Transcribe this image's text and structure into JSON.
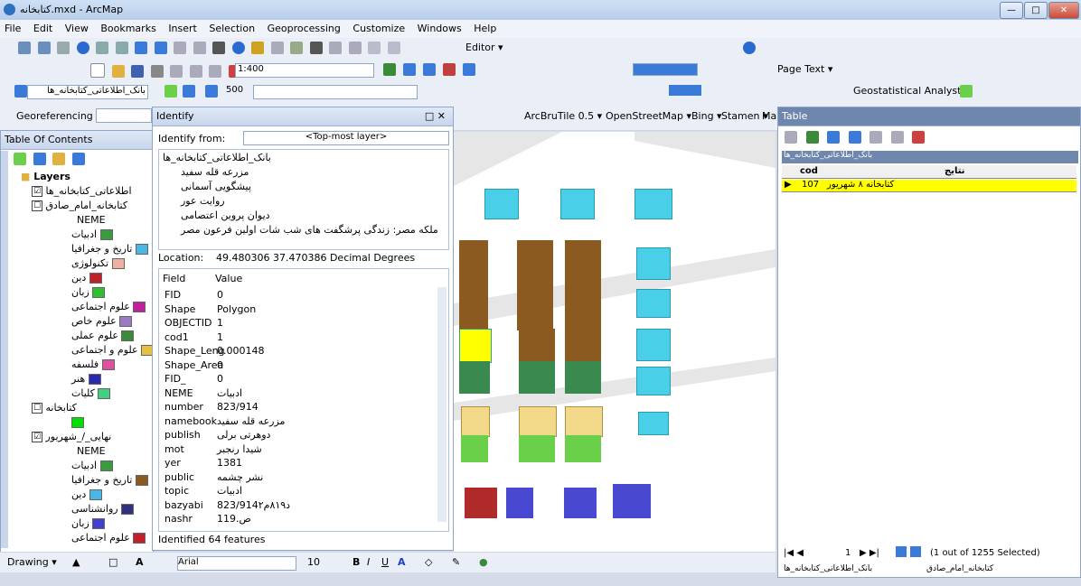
{
  "window": {
    "title": "کتابخانه.mxd - ArcMap",
    "min": "—",
    "max": "□",
    "close": "✕"
  },
  "menu": [
    "File",
    "Edit",
    "View",
    "Bookmarks",
    "Insert",
    "Selection",
    "Geoprocessing",
    "Customize",
    "Windows",
    "Help"
  ],
  "toolbar": {
    "editor": "Editor ▾",
    "scale": "1:400",
    "page_text": "Page Text ▾",
    "layer_select": "بانک_اطلاعاتی_کتابخانه_ها",
    "zoom_val": "500",
    "geostat": "Geostatistical Analyst ▾",
    "georef": "Georeferencing ▾",
    "basemap": "ArcBruTile 0.5 ▾",
    "osm": "OpenStreetMap ▾",
    "bing": "Bing ▾",
    "stamen": "Stamen ▾",
    "ma": "Ma",
    "drawing": "Drawing ▾",
    "font": "Arial",
    "font_size": "10",
    "bold": "B",
    "italic": "I",
    "underline": "U"
  },
  "toc": {
    "title": "Table Of Contents",
    "side_tab": "ArcToolbox",
    "layers_root": "Layers",
    "items": [
      {
        "label": "اطلاعاتی_کتابخانه_ها",
        "type": "layer",
        "checked": "☑"
      },
      {
        "label": "کتابخانه_امام_صادق",
        "type": "layer",
        "checked": "☐"
      },
      {
        "label": "NEME",
        "type": "field"
      },
      {
        "label": "ادبیات",
        "type": "cat",
        "color": "#3b9a3b"
      },
      {
        "label": "تاریخ و جغرافیا",
        "type": "cat",
        "color": "#49b6e6"
      },
      {
        "label": "تکنولوژی",
        "type": "cat",
        "color": "#f0b0a0"
      },
      {
        "label": "دین",
        "type": "cat",
        "color": "#c0202a"
      },
      {
        "label": "زبان",
        "type": "cat",
        "color": "#2fbf2f"
      },
      {
        "label": "علوم اجتماعی",
        "type": "cat",
        "color": "#c0209a"
      },
      {
        "label": "علوم خاص",
        "type": "cat",
        "color": "#9a7ac0"
      },
      {
        "label": "علوم عملی",
        "type": "cat",
        "color": "#3a8a3a"
      },
      {
        "label": "علوم و اجتماعی",
        "type": "cat",
        "color": "#e6c040"
      },
      {
        "label": "فلسفه",
        "type": "cat",
        "color": "#e050a0"
      },
      {
        "label": "هنر",
        "type": "cat",
        "color": "#2a2ab0"
      },
      {
        "label": "کلیات",
        "type": "cat",
        "color": "#40d080"
      },
      {
        "label": "کتابخانه",
        "type": "layer",
        "checked": "☐"
      },
      {
        "label": "",
        "type": "cat",
        "color": "#00e000"
      },
      {
        "label": "نهایی_/_شهریور",
        "type": "layer",
        "checked": "☑"
      },
      {
        "label": "NEME",
        "type": "field"
      },
      {
        "label": "ادبیات",
        "type": "cat",
        "color": "#3b9a3b"
      },
      {
        "label": "تاریخ و جغرافیا",
        "type": "cat",
        "color": "#8a5a20"
      },
      {
        "label": "دین",
        "type": "cat",
        "color": "#49b6e6"
      },
      {
        "label": "روانشناسی",
        "type": "cat",
        "color": "#303080"
      },
      {
        "label": "زبان",
        "type": "cat",
        "color": "#4040d0"
      },
      {
        "label": "علوم اجتماعی",
        "type": "cat",
        "color": "#c0202a"
      }
    ]
  },
  "identify": {
    "title": "Identify",
    "from_label": "Identify from:",
    "from_value": "<Top-most layer>",
    "tree_root": "بانک_اطلاعاتی_کتابخانه_ها",
    "tree_items": [
      "مزرعه قله سفید",
      "پیشگویی آسمانی",
      "روایت عور",
      "دیوان پروین اعتصامی",
      "ملکه مصر: زندگی پرشگفت های شب شات اولین فرعون مصر"
    ],
    "location_label": "Location:",
    "location_value": "49.480306 37.470386 Decimal Degrees",
    "col_field": "Field",
    "col_value": "Value",
    "rows": [
      {
        "f": "FID",
        "v": "0"
      },
      {
        "f": "Shape",
        "v": "Polygon"
      },
      {
        "f": "OBJECTID",
        "v": "1"
      },
      {
        "f": "cod1",
        "v": "1"
      },
      {
        "f": "Shape_Leng",
        "v": "0.000148"
      },
      {
        "f": "Shape_Area",
        "v": "0"
      },
      {
        "f": "FID_",
        "v": "0"
      },
      {
        "f": "NEME",
        "v": "ادبیات"
      },
      {
        "f": "number",
        "v": "823/914"
      },
      {
        "f": "namebook",
        "v": "مزرعه قله سفید"
      },
      {
        "f": "publish",
        "v": "دوهرتی برلی"
      },
      {
        "f": "mot",
        "v": "شیدا رنجبر"
      },
      {
        "f": "yer",
        "v": "1381"
      },
      {
        "f": "public",
        "v": "نشر چشمه"
      },
      {
        "f": "topic",
        "v": "ادبیات"
      },
      {
        "f": "bazyabi",
        "v": "823/914د۸۱۹م۲"
      },
      {
        "f": "nashr",
        "v": "119.ص"
      }
    ],
    "status": "Identified 64 features"
  },
  "table": {
    "title": "Table",
    "layer_name": "بانک_اطلاعاتی_کتابخانه_ها",
    "col_cod": "cod",
    "col_name": "نتایج",
    "row_cod": "107",
    "row_name": "کتابخانه ۸ شهریور",
    "nav_first": "|◀ ◀",
    "nav_page": "1",
    "nav_next": "▶ ▶|",
    "selected": "(1 out of 1255 Selected)",
    "tabs": [
      "بانک_اطلاعاتی_کتابخانه_ها",
      "کتابخانه_امام_صادق"
    ]
  },
  "colors": {
    "selected_row": "#ffff00",
    "brown": "#8a5a20",
    "cyan": "#49d0e8",
    "green": "#3a8a50",
    "tan": "#f2d98a",
    "lime": "#6ad04a",
    "red": "#b02a2a",
    "blue": "#4848d0",
    "yellow": "#ffff00"
  }
}
